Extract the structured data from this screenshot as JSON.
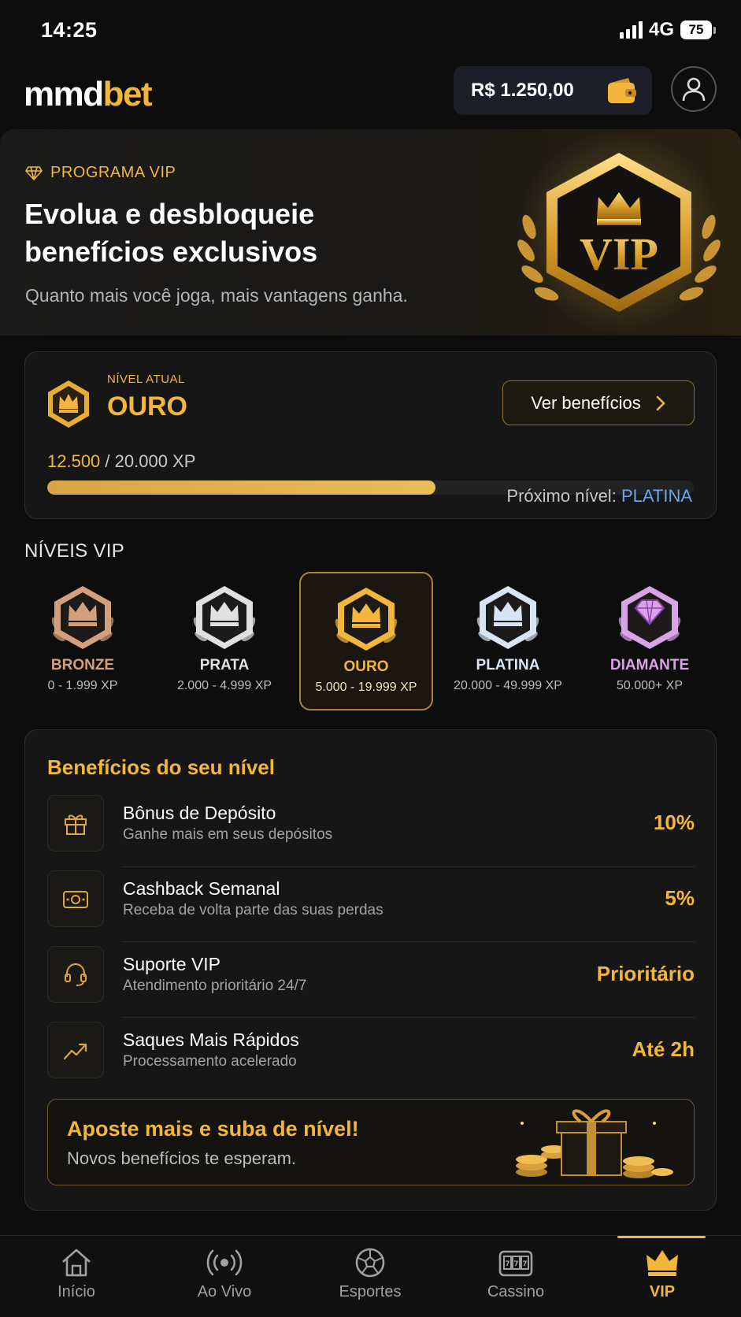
{
  "status_bar": {
    "time": "14:25",
    "network": "4G",
    "battery": "75"
  },
  "header": {
    "logo_part1": "mmd",
    "logo_part2": "bet",
    "balance": "R$ 1.250,00",
    "wallet_icon": "wallet-icon",
    "avatar_icon": "user-icon"
  },
  "hero": {
    "tag": "PROGRAMA VIP",
    "title_line1": "Evolua e desbloqueie",
    "title_line2": "benefícios exclusivos",
    "subtitle": "Quanto mais você joga, mais vantagens ganha.",
    "emblem_text": "VIP"
  },
  "current_level": {
    "caption": "NÍVEL ATUAL",
    "name": "OURO",
    "benefits_button": "Ver benefícios",
    "xp_current": "12.500",
    "xp_target": "/ 20.000 XP",
    "progress_fraction": 0.6,
    "next_label": "Próximo nível:",
    "next_name": "PLATINA"
  },
  "tiers_section": {
    "title": "NÍVEIS VIP",
    "tiers": [
      {
        "name": "BRONZE",
        "range": "0 - 1.999 XP",
        "color": "#d4a07c",
        "active": false
      },
      {
        "name": "PRATA",
        "range": "2.000 - 4.999 XP",
        "color": "#e0e0e0",
        "active": false
      },
      {
        "name": "OURO",
        "range": "5.000 - 19.999 XP",
        "color": "#f2b63d",
        "active": true
      },
      {
        "name": "PLATINA",
        "range": "20.000 - 49.999 XP",
        "color": "#d8e4f2",
        "active": false
      },
      {
        "name": "DIAMANTE",
        "range": "50.000+ XP",
        "color": "#d9a3e8",
        "active": false
      }
    ]
  },
  "benefits": {
    "title": "Benefícios do seu nível",
    "items": [
      {
        "icon": "gift-icon",
        "name": "Bônus de Depósito",
        "desc": "Ganhe mais em seus depósitos",
        "value": "10%"
      },
      {
        "icon": "cash-icon",
        "name": "Cashback Semanal",
        "desc": "Receba de volta parte das suas perdas",
        "value": "5%"
      },
      {
        "icon": "headset-icon",
        "name": "Suporte VIP",
        "desc": "Atendimento prioritário 24/7",
        "value": "Prioritário"
      },
      {
        "icon": "trend-up-icon",
        "name": "Saques Mais Rápidos",
        "desc": "Processamento acelerado",
        "value": "Até 2h"
      }
    ],
    "promo_title": "Aposte mais e suba de nível!",
    "promo_subtitle": "Novos benefícios te esperam."
  },
  "nav": {
    "items": [
      {
        "label": "Início",
        "icon": "home-icon"
      },
      {
        "label": "Ao Vivo",
        "icon": "live-icon"
      },
      {
        "label": "Esportes",
        "icon": "ball-icon"
      },
      {
        "label": "Cassino",
        "icon": "slot-icon"
      },
      {
        "label": "VIP",
        "icon": "crown-icon",
        "active": true
      }
    ]
  },
  "colors": {
    "accent": "#f2b63d",
    "platinum_link": "#6aa6e8",
    "background": "#0d0d0d"
  }
}
